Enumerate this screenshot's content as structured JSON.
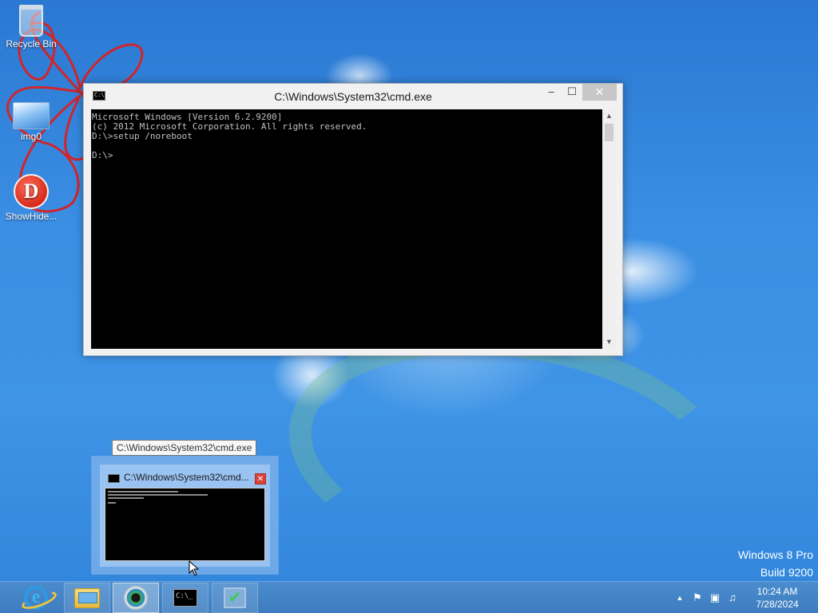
{
  "desktop": {
    "icons": [
      {
        "label": "Recycle Bin",
        "icon": "recycle-bin-icon"
      },
      {
        "label": "img0",
        "icon": "image-file-icon"
      },
      {
        "label": "ShowHide...",
        "icon": "showhide-app-icon"
      }
    ],
    "watermark": {
      "line1": "Windows 8 Pro",
      "line2": "Build 9200"
    }
  },
  "cmd_window": {
    "title": "C:\\Windows\\System32\\cmd.exe",
    "icon_text": "C:\\",
    "minimize": "–",
    "maximize": "☐",
    "close": "✕",
    "console_lines": [
      "Microsoft Windows [Version 6.2.9200]",
      "(c) 2012 Microsoft Corporation. All rights reserved.",
      "",
      "D:\\>setup /noreboot",
      "",
      "D:\\>"
    ]
  },
  "taskbar_preview": {
    "tooltip": "C:\\Windows\\System32\\cmd.exe",
    "title": "C:\\Windows\\System32\\cmd...",
    "close": "✕"
  },
  "taskbar": {
    "items": [
      {
        "name": "internet-explorer",
        "glyph": "e"
      },
      {
        "name": "file-explorer",
        "glyph": ""
      },
      {
        "name": "media-center",
        "glyph": ""
      },
      {
        "name": "command-prompt",
        "glyph": "C:\\_"
      },
      {
        "name": "setup",
        "glyph": "✔"
      }
    ],
    "tray": {
      "show_hidden": "▲",
      "flag": "⚑",
      "network": "▣",
      "volume": "♫"
    },
    "clock": {
      "time": "10:24 AM",
      "date": "7/28/2024"
    }
  },
  "colors": {
    "desktop_blue": "#2d7fd8",
    "taskbar_blue": "#3d7dc0",
    "console_bg": "#000000",
    "console_text": "#c0c0c0"
  }
}
